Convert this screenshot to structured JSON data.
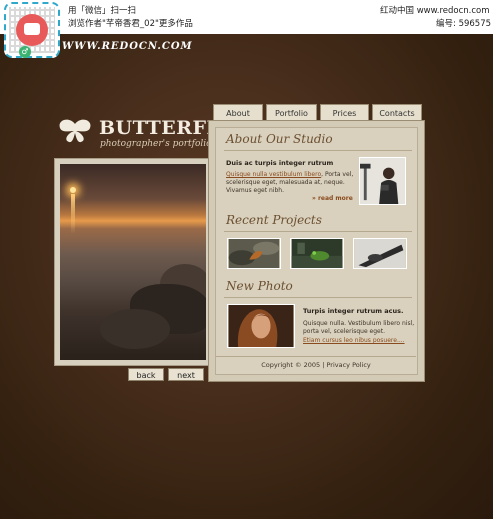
{
  "watermark": {
    "scan_line": "用「微信」扫一扫",
    "browse_line": "浏览作者\"芊帝香君_02\"更多作品",
    "site_name": "红动中国 www.redocn.com",
    "id_label": "编号: 596575",
    "url_banner": "WWW.REDOCN.COM",
    "badge_glyph": "♂"
  },
  "logo": {
    "title": "BUTTERFLY",
    "subtitle": "photographer's portfolio"
  },
  "tabs": [
    "About",
    "Portfolio",
    "Prices",
    "Contacts"
  ],
  "nav": {
    "back": "back",
    "next": "next"
  },
  "about": {
    "heading": "About Our Studio",
    "lead": "Duis ac turpis integer rutrum",
    "line1_link": "Quisque nulla vestibulum libero",
    "line1_rest": ", Porta vel,",
    "line2": "scelerisque eget, malesuada at, neque.",
    "line3": "Vivamus eget nibh.",
    "more": "» read more"
  },
  "projects": {
    "heading": "Recent Projects"
  },
  "new_photo": {
    "heading": "New Photo",
    "lead": "Turpis integer rutrum acus.",
    "line1": "Quisque nulla. Vestibulum libero nisl,",
    "line2": "porta vel, scelerisque eget.",
    "link": "Etiam cursus leo nibus posuere...."
  },
  "footer": {
    "text": "Copyright © 2005  |  Privacy Policy"
  },
  "colors": {
    "background": "#3b2416",
    "panel": "#d9d1bd",
    "heading": "#6b4f31",
    "link": "#8a4b1e"
  }
}
